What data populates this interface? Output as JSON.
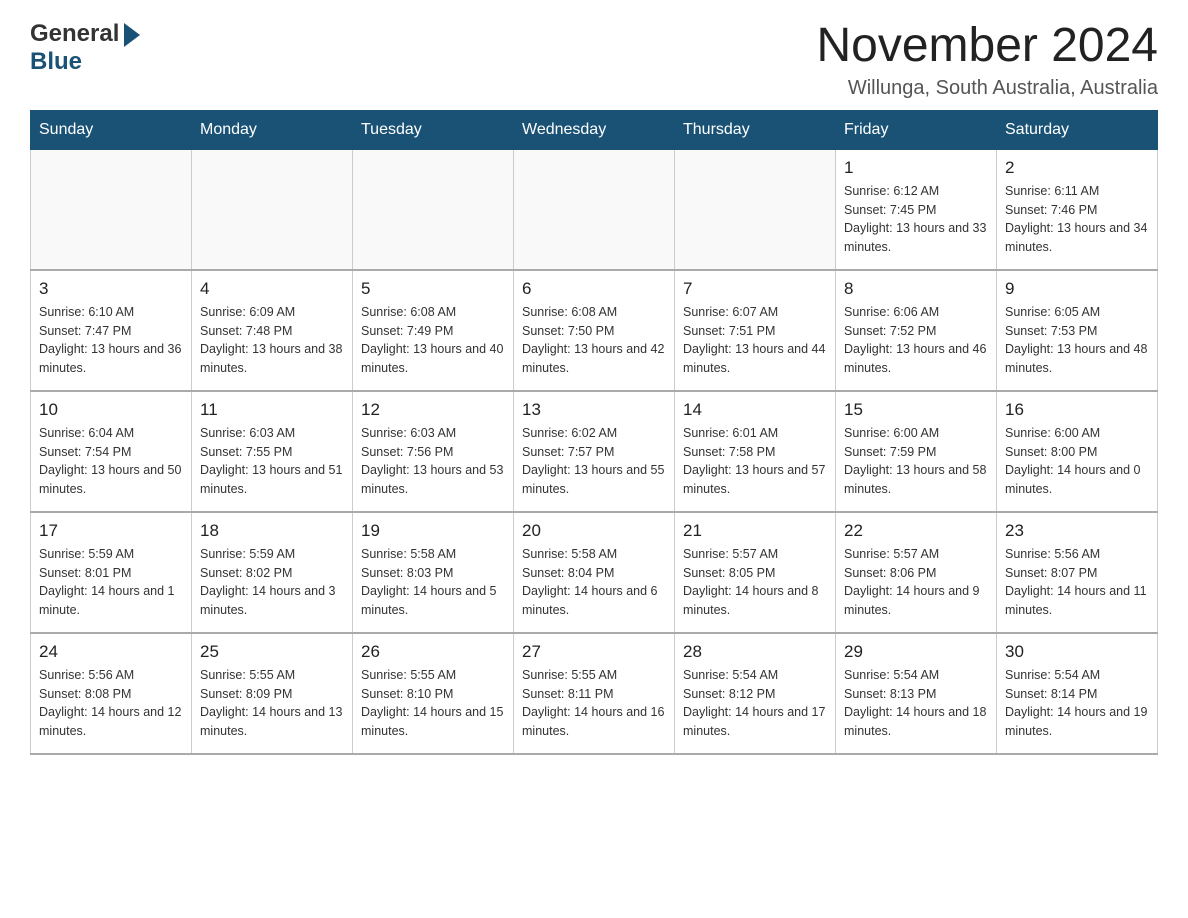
{
  "header": {
    "logo": {
      "text_general": "General",
      "text_triangle": "▶",
      "text_blue": "Blue"
    },
    "month_title": "November 2024",
    "location": "Willunga, South Australia, Australia"
  },
  "days_of_week": [
    "Sunday",
    "Monday",
    "Tuesday",
    "Wednesday",
    "Thursday",
    "Friday",
    "Saturday"
  ],
  "weeks": [
    [
      {
        "day": "",
        "sunrise": "",
        "sunset": "",
        "daylight": ""
      },
      {
        "day": "",
        "sunrise": "",
        "sunset": "",
        "daylight": ""
      },
      {
        "day": "",
        "sunrise": "",
        "sunset": "",
        "daylight": ""
      },
      {
        "day": "",
        "sunrise": "",
        "sunset": "",
        "daylight": ""
      },
      {
        "day": "",
        "sunrise": "",
        "sunset": "",
        "daylight": ""
      },
      {
        "day": "1",
        "sunrise": "Sunrise: 6:12 AM",
        "sunset": "Sunset: 7:45 PM",
        "daylight": "Daylight: 13 hours and 33 minutes."
      },
      {
        "day": "2",
        "sunrise": "Sunrise: 6:11 AM",
        "sunset": "Sunset: 7:46 PM",
        "daylight": "Daylight: 13 hours and 34 minutes."
      }
    ],
    [
      {
        "day": "3",
        "sunrise": "Sunrise: 6:10 AM",
        "sunset": "Sunset: 7:47 PM",
        "daylight": "Daylight: 13 hours and 36 minutes."
      },
      {
        "day": "4",
        "sunrise": "Sunrise: 6:09 AM",
        "sunset": "Sunset: 7:48 PM",
        "daylight": "Daylight: 13 hours and 38 minutes."
      },
      {
        "day": "5",
        "sunrise": "Sunrise: 6:08 AM",
        "sunset": "Sunset: 7:49 PM",
        "daylight": "Daylight: 13 hours and 40 minutes."
      },
      {
        "day": "6",
        "sunrise": "Sunrise: 6:08 AM",
        "sunset": "Sunset: 7:50 PM",
        "daylight": "Daylight: 13 hours and 42 minutes."
      },
      {
        "day": "7",
        "sunrise": "Sunrise: 6:07 AM",
        "sunset": "Sunset: 7:51 PM",
        "daylight": "Daylight: 13 hours and 44 minutes."
      },
      {
        "day": "8",
        "sunrise": "Sunrise: 6:06 AM",
        "sunset": "Sunset: 7:52 PM",
        "daylight": "Daylight: 13 hours and 46 minutes."
      },
      {
        "day": "9",
        "sunrise": "Sunrise: 6:05 AM",
        "sunset": "Sunset: 7:53 PM",
        "daylight": "Daylight: 13 hours and 48 minutes."
      }
    ],
    [
      {
        "day": "10",
        "sunrise": "Sunrise: 6:04 AM",
        "sunset": "Sunset: 7:54 PM",
        "daylight": "Daylight: 13 hours and 50 minutes."
      },
      {
        "day": "11",
        "sunrise": "Sunrise: 6:03 AM",
        "sunset": "Sunset: 7:55 PM",
        "daylight": "Daylight: 13 hours and 51 minutes."
      },
      {
        "day": "12",
        "sunrise": "Sunrise: 6:03 AM",
        "sunset": "Sunset: 7:56 PM",
        "daylight": "Daylight: 13 hours and 53 minutes."
      },
      {
        "day": "13",
        "sunrise": "Sunrise: 6:02 AM",
        "sunset": "Sunset: 7:57 PM",
        "daylight": "Daylight: 13 hours and 55 minutes."
      },
      {
        "day": "14",
        "sunrise": "Sunrise: 6:01 AM",
        "sunset": "Sunset: 7:58 PM",
        "daylight": "Daylight: 13 hours and 57 minutes."
      },
      {
        "day": "15",
        "sunrise": "Sunrise: 6:00 AM",
        "sunset": "Sunset: 7:59 PM",
        "daylight": "Daylight: 13 hours and 58 minutes."
      },
      {
        "day": "16",
        "sunrise": "Sunrise: 6:00 AM",
        "sunset": "Sunset: 8:00 PM",
        "daylight": "Daylight: 14 hours and 0 minutes."
      }
    ],
    [
      {
        "day": "17",
        "sunrise": "Sunrise: 5:59 AM",
        "sunset": "Sunset: 8:01 PM",
        "daylight": "Daylight: 14 hours and 1 minute."
      },
      {
        "day": "18",
        "sunrise": "Sunrise: 5:59 AM",
        "sunset": "Sunset: 8:02 PM",
        "daylight": "Daylight: 14 hours and 3 minutes."
      },
      {
        "day": "19",
        "sunrise": "Sunrise: 5:58 AM",
        "sunset": "Sunset: 8:03 PM",
        "daylight": "Daylight: 14 hours and 5 minutes."
      },
      {
        "day": "20",
        "sunrise": "Sunrise: 5:58 AM",
        "sunset": "Sunset: 8:04 PM",
        "daylight": "Daylight: 14 hours and 6 minutes."
      },
      {
        "day": "21",
        "sunrise": "Sunrise: 5:57 AM",
        "sunset": "Sunset: 8:05 PM",
        "daylight": "Daylight: 14 hours and 8 minutes."
      },
      {
        "day": "22",
        "sunrise": "Sunrise: 5:57 AM",
        "sunset": "Sunset: 8:06 PM",
        "daylight": "Daylight: 14 hours and 9 minutes."
      },
      {
        "day": "23",
        "sunrise": "Sunrise: 5:56 AM",
        "sunset": "Sunset: 8:07 PM",
        "daylight": "Daylight: 14 hours and 11 minutes."
      }
    ],
    [
      {
        "day": "24",
        "sunrise": "Sunrise: 5:56 AM",
        "sunset": "Sunset: 8:08 PM",
        "daylight": "Daylight: 14 hours and 12 minutes."
      },
      {
        "day": "25",
        "sunrise": "Sunrise: 5:55 AM",
        "sunset": "Sunset: 8:09 PM",
        "daylight": "Daylight: 14 hours and 13 minutes."
      },
      {
        "day": "26",
        "sunrise": "Sunrise: 5:55 AM",
        "sunset": "Sunset: 8:10 PM",
        "daylight": "Daylight: 14 hours and 15 minutes."
      },
      {
        "day": "27",
        "sunrise": "Sunrise: 5:55 AM",
        "sunset": "Sunset: 8:11 PM",
        "daylight": "Daylight: 14 hours and 16 minutes."
      },
      {
        "day": "28",
        "sunrise": "Sunrise: 5:54 AM",
        "sunset": "Sunset: 8:12 PM",
        "daylight": "Daylight: 14 hours and 17 minutes."
      },
      {
        "day": "29",
        "sunrise": "Sunrise: 5:54 AM",
        "sunset": "Sunset: 8:13 PM",
        "daylight": "Daylight: 14 hours and 18 minutes."
      },
      {
        "day": "30",
        "sunrise": "Sunrise: 5:54 AM",
        "sunset": "Sunset: 8:14 PM",
        "daylight": "Daylight: 14 hours and 19 minutes."
      }
    ]
  ]
}
